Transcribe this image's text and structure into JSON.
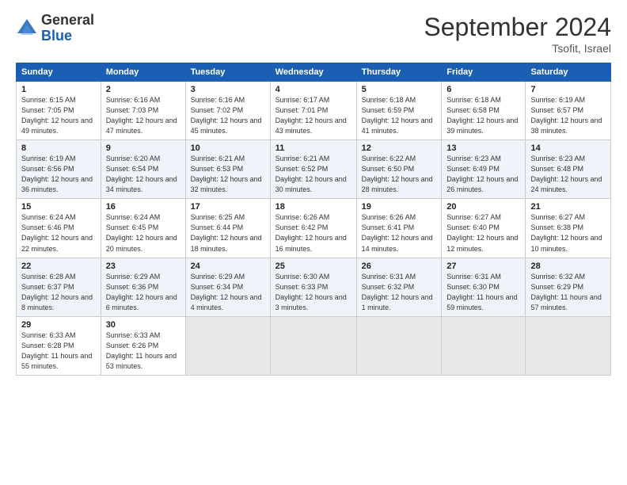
{
  "header": {
    "logo_general": "General",
    "logo_blue": "Blue",
    "month_title": "September 2024",
    "location": "Tsofit, Israel"
  },
  "weekdays": [
    "Sunday",
    "Monday",
    "Tuesday",
    "Wednesday",
    "Thursday",
    "Friday",
    "Saturday"
  ],
  "weeks": [
    [
      {
        "day": "1",
        "sunrise": "Sunrise: 6:15 AM",
        "sunset": "Sunset: 7:05 PM",
        "daylight": "Daylight: 12 hours and 49 minutes."
      },
      {
        "day": "2",
        "sunrise": "Sunrise: 6:16 AM",
        "sunset": "Sunset: 7:03 PM",
        "daylight": "Daylight: 12 hours and 47 minutes."
      },
      {
        "day": "3",
        "sunrise": "Sunrise: 6:16 AM",
        "sunset": "Sunset: 7:02 PM",
        "daylight": "Daylight: 12 hours and 45 minutes."
      },
      {
        "day": "4",
        "sunrise": "Sunrise: 6:17 AM",
        "sunset": "Sunset: 7:01 PM",
        "daylight": "Daylight: 12 hours and 43 minutes."
      },
      {
        "day": "5",
        "sunrise": "Sunrise: 6:18 AM",
        "sunset": "Sunset: 6:59 PM",
        "daylight": "Daylight: 12 hours and 41 minutes."
      },
      {
        "day": "6",
        "sunrise": "Sunrise: 6:18 AM",
        "sunset": "Sunset: 6:58 PM",
        "daylight": "Daylight: 12 hours and 39 minutes."
      },
      {
        "day": "7",
        "sunrise": "Sunrise: 6:19 AM",
        "sunset": "Sunset: 6:57 PM",
        "daylight": "Daylight: 12 hours and 38 minutes."
      }
    ],
    [
      {
        "day": "8",
        "sunrise": "Sunrise: 6:19 AM",
        "sunset": "Sunset: 6:56 PM",
        "daylight": "Daylight: 12 hours and 36 minutes."
      },
      {
        "day": "9",
        "sunrise": "Sunrise: 6:20 AM",
        "sunset": "Sunset: 6:54 PM",
        "daylight": "Daylight: 12 hours and 34 minutes."
      },
      {
        "day": "10",
        "sunrise": "Sunrise: 6:21 AM",
        "sunset": "Sunset: 6:53 PM",
        "daylight": "Daylight: 12 hours and 32 minutes."
      },
      {
        "day": "11",
        "sunrise": "Sunrise: 6:21 AM",
        "sunset": "Sunset: 6:52 PM",
        "daylight": "Daylight: 12 hours and 30 minutes."
      },
      {
        "day": "12",
        "sunrise": "Sunrise: 6:22 AM",
        "sunset": "Sunset: 6:50 PM",
        "daylight": "Daylight: 12 hours and 28 minutes."
      },
      {
        "day": "13",
        "sunrise": "Sunrise: 6:23 AM",
        "sunset": "Sunset: 6:49 PM",
        "daylight": "Daylight: 12 hours and 26 minutes."
      },
      {
        "day": "14",
        "sunrise": "Sunrise: 6:23 AM",
        "sunset": "Sunset: 6:48 PM",
        "daylight": "Daylight: 12 hours and 24 minutes."
      }
    ],
    [
      {
        "day": "15",
        "sunrise": "Sunrise: 6:24 AM",
        "sunset": "Sunset: 6:46 PM",
        "daylight": "Daylight: 12 hours and 22 minutes."
      },
      {
        "day": "16",
        "sunrise": "Sunrise: 6:24 AM",
        "sunset": "Sunset: 6:45 PM",
        "daylight": "Daylight: 12 hours and 20 minutes."
      },
      {
        "day": "17",
        "sunrise": "Sunrise: 6:25 AM",
        "sunset": "Sunset: 6:44 PM",
        "daylight": "Daylight: 12 hours and 18 minutes."
      },
      {
        "day": "18",
        "sunrise": "Sunrise: 6:26 AM",
        "sunset": "Sunset: 6:42 PM",
        "daylight": "Daylight: 12 hours and 16 minutes."
      },
      {
        "day": "19",
        "sunrise": "Sunrise: 6:26 AM",
        "sunset": "Sunset: 6:41 PM",
        "daylight": "Daylight: 12 hours and 14 minutes."
      },
      {
        "day": "20",
        "sunrise": "Sunrise: 6:27 AM",
        "sunset": "Sunset: 6:40 PM",
        "daylight": "Daylight: 12 hours and 12 minutes."
      },
      {
        "day": "21",
        "sunrise": "Sunrise: 6:27 AM",
        "sunset": "Sunset: 6:38 PM",
        "daylight": "Daylight: 12 hours and 10 minutes."
      }
    ],
    [
      {
        "day": "22",
        "sunrise": "Sunrise: 6:28 AM",
        "sunset": "Sunset: 6:37 PM",
        "daylight": "Daylight: 12 hours and 8 minutes."
      },
      {
        "day": "23",
        "sunrise": "Sunrise: 6:29 AM",
        "sunset": "Sunset: 6:36 PM",
        "daylight": "Daylight: 12 hours and 6 minutes."
      },
      {
        "day": "24",
        "sunrise": "Sunrise: 6:29 AM",
        "sunset": "Sunset: 6:34 PM",
        "daylight": "Daylight: 12 hours and 4 minutes."
      },
      {
        "day": "25",
        "sunrise": "Sunrise: 6:30 AM",
        "sunset": "Sunset: 6:33 PM",
        "daylight": "Daylight: 12 hours and 3 minutes."
      },
      {
        "day": "26",
        "sunrise": "Sunrise: 6:31 AM",
        "sunset": "Sunset: 6:32 PM",
        "daylight": "Daylight: 12 hours and 1 minute."
      },
      {
        "day": "27",
        "sunrise": "Sunrise: 6:31 AM",
        "sunset": "Sunset: 6:30 PM",
        "daylight": "Daylight: 11 hours and 59 minutes."
      },
      {
        "day": "28",
        "sunrise": "Sunrise: 6:32 AM",
        "sunset": "Sunset: 6:29 PM",
        "daylight": "Daylight: 11 hours and 57 minutes."
      }
    ],
    [
      {
        "day": "29",
        "sunrise": "Sunrise: 6:33 AM",
        "sunset": "Sunset: 6:28 PM",
        "daylight": "Daylight: 11 hours and 55 minutes."
      },
      {
        "day": "30",
        "sunrise": "Sunrise: 6:33 AM",
        "sunset": "Sunset: 6:26 PM",
        "daylight": "Daylight: 11 hours and 53 minutes."
      },
      null,
      null,
      null,
      null,
      null
    ]
  ]
}
